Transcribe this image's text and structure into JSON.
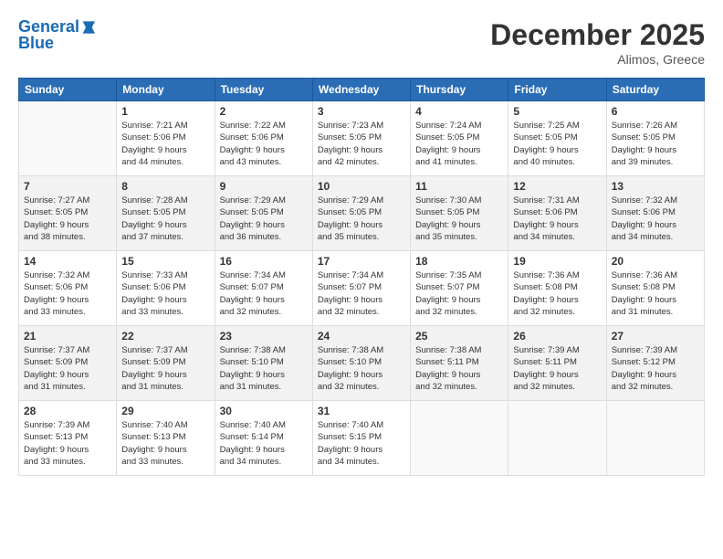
{
  "logo": {
    "line1": "General",
    "line2": "Blue"
  },
  "title": "December 2025",
  "location": "Alimos, Greece",
  "headers": [
    "Sunday",
    "Monday",
    "Tuesday",
    "Wednesday",
    "Thursday",
    "Friday",
    "Saturday"
  ],
  "weeks": [
    [
      {
        "day": "",
        "info": ""
      },
      {
        "day": "1",
        "info": "Sunrise: 7:21 AM\nSunset: 5:06 PM\nDaylight: 9 hours\nand 44 minutes."
      },
      {
        "day": "2",
        "info": "Sunrise: 7:22 AM\nSunset: 5:06 PM\nDaylight: 9 hours\nand 43 minutes."
      },
      {
        "day": "3",
        "info": "Sunrise: 7:23 AM\nSunset: 5:05 PM\nDaylight: 9 hours\nand 42 minutes."
      },
      {
        "day": "4",
        "info": "Sunrise: 7:24 AM\nSunset: 5:05 PM\nDaylight: 9 hours\nand 41 minutes."
      },
      {
        "day": "5",
        "info": "Sunrise: 7:25 AM\nSunset: 5:05 PM\nDaylight: 9 hours\nand 40 minutes."
      },
      {
        "day": "6",
        "info": "Sunrise: 7:26 AM\nSunset: 5:05 PM\nDaylight: 9 hours\nand 39 minutes."
      }
    ],
    [
      {
        "day": "7",
        "info": "Sunrise: 7:27 AM\nSunset: 5:05 PM\nDaylight: 9 hours\nand 38 minutes."
      },
      {
        "day": "8",
        "info": "Sunrise: 7:28 AM\nSunset: 5:05 PM\nDaylight: 9 hours\nand 37 minutes."
      },
      {
        "day": "9",
        "info": "Sunrise: 7:29 AM\nSunset: 5:05 PM\nDaylight: 9 hours\nand 36 minutes."
      },
      {
        "day": "10",
        "info": "Sunrise: 7:29 AM\nSunset: 5:05 PM\nDaylight: 9 hours\nand 35 minutes."
      },
      {
        "day": "11",
        "info": "Sunrise: 7:30 AM\nSunset: 5:05 PM\nDaylight: 9 hours\nand 35 minutes."
      },
      {
        "day": "12",
        "info": "Sunrise: 7:31 AM\nSunset: 5:06 PM\nDaylight: 9 hours\nand 34 minutes."
      },
      {
        "day": "13",
        "info": "Sunrise: 7:32 AM\nSunset: 5:06 PM\nDaylight: 9 hours\nand 34 minutes."
      }
    ],
    [
      {
        "day": "14",
        "info": "Sunrise: 7:32 AM\nSunset: 5:06 PM\nDaylight: 9 hours\nand 33 minutes."
      },
      {
        "day": "15",
        "info": "Sunrise: 7:33 AM\nSunset: 5:06 PM\nDaylight: 9 hours\nand 33 minutes."
      },
      {
        "day": "16",
        "info": "Sunrise: 7:34 AM\nSunset: 5:07 PM\nDaylight: 9 hours\nand 32 minutes."
      },
      {
        "day": "17",
        "info": "Sunrise: 7:34 AM\nSunset: 5:07 PM\nDaylight: 9 hours\nand 32 minutes."
      },
      {
        "day": "18",
        "info": "Sunrise: 7:35 AM\nSunset: 5:07 PM\nDaylight: 9 hours\nand 32 minutes."
      },
      {
        "day": "19",
        "info": "Sunrise: 7:36 AM\nSunset: 5:08 PM\nDaylight: 9 hours\nand 32 minutes."
      },
      {
        "day": "20",
        "info": "Sunrise: 7:36 AM\nSunset: 5:08 PM\nDaylight: 9 hours\nand 31 minutes."
      }
    ],
    [
      {
        "day": "21",
        "info": "Sunrise: 7:37 AM\nSunset: 5:09 PM\nDaylight: 9 hours\nand 31 minutes."
      },
      {
        "day": "22",
        "info": "Sunrise: 7:37 AM\nSunset: 5:09 PM\nDaylight: 9 hours\nand 31 minutes."
      },
      {
        "day": "23",
        "info": "Sunrise: 7:38 AM\nSunset: 5:10 PM\nDaylight: 9 hours\nand 31 minutes."
      },
      {
        "day": "24",
        "info": "Sunrise: 7:38 AM\nSunset: 5:10 PM\nDaylight: 9 hours\nand 32 minutes."
      },
      {
        "day": "25",
        "info": "Sunrise: 7:38 AM\nSunset: 5:11 PM\nDaylight: 9 hours\nand 32 minutes."
      },
      {
        "day": "26",
        "info": "Sunrise: 7:39 AM\nSunset: 5:11 PM\nDaylight: 9 hours\nand 32 minutes."
      },
      {
        "day": "27",
        "info": "Sunrise: 7:39 AM\nSunset: 5:12 PM\nDaylight: 9 hours\nand 32 minutes."
      }
    ],
    [
      {
        "day": "28",
        "info": "Sunrise: 7:39 AM\nSunset: 5:13 PM\nDaylight: 9 hours\nand 33 minutes."
      },
      {
        "day": "29",
        "info": "Sunrise: 7:40 AM\nSunset: 5:13 PM\nDaylight: 9 hours\nand 33 minutes."
      },
      {
        "day": "30",
        "info": "Sunrise: 7:40 AM\nSunset: 5:14 PM\nDaylight: 9 hours\nand 34 minutes."
      },
      {
        "day": "31",
        "info": "Sunrise: 7:40 AM\nSunset: 5:15 PM\nDaylight: 9 hours\nand 34 minutes."
      },
      {
        "day": "",
        "info": ""
      },
      {
        "day": "",
        "info": ""
      },
      {
        "day": "",
        "info": ""
      }
    ]
  ]
}
